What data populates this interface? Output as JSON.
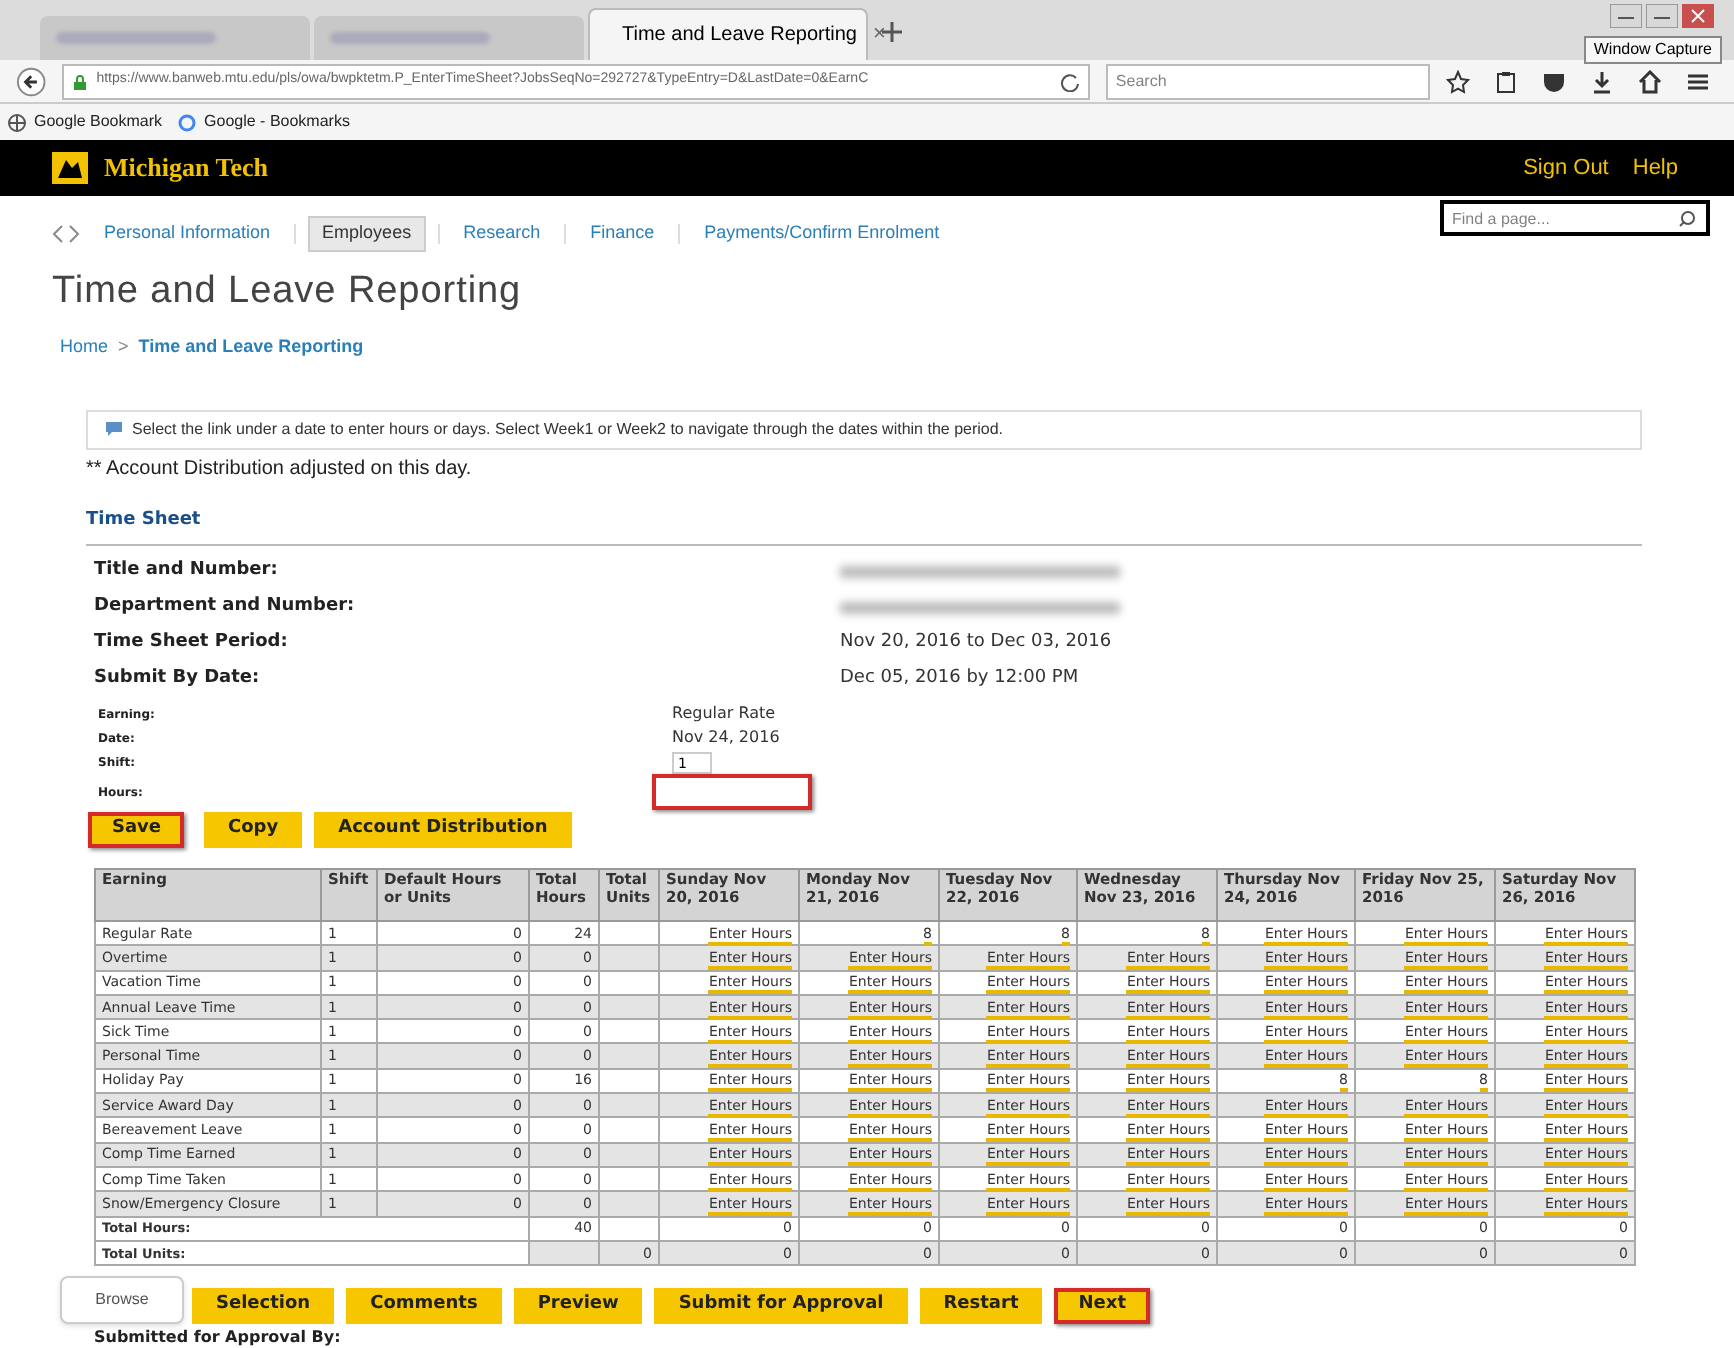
{
  "browser": {
    "tabs": [
      {
        "selected": false
      },
      {
        "selected": false
      },
      {
        "label": "Time and Leave Reporting",
        "selected": true,
        "close": "×"
      }
    ],
    "url": "https://www.banweb.mtu.edu/pls/owa/bwpktetm.P_EnterTimeSheet?JobsSeqNo=292727&TypeEntry=D&LastDate=0&EarnC",
    "search_placeholder": "Search",
    "bookmarks": [
      "Google Bookmark",
      "Google - Bookmarks"
    ],
    "tooltip": "Window Capture"
  },
  "header": {
    "brand": "Michigan Tech",
    "links": [
      "Sign Out",
      "Help"
    ],
    "find_placeholder": "Find a page..."
  },
  "nav": [
    {
      "label": "Personal Information",
      "selected": false
    },
    {
      "label": "Employees",
      "selected": true
    },
    {
      "label": "Research",
      "selected": false
    },
    {
      "label": "Finance",
      "selected": false
    },
    {
      "label": "Payments/Confirm Enrolment",
      "selected": false
    }
  ],
  "page_title": "Time and Leave Reporting",
  "breadcrumb": [
    "Home",
    ">",
    "Time and Leave Reporting"
  ],
  "info": "Select the link under a date to enter hours or days. Select Week1 or Week2 to navigate through the dates within the period.",
  "note": "** Account Distribution adjusted on this day.",
  "section": "Time Sheet",
  "details": [
    {
      "label": "Title and Number:",
      "redacted": true
    },
    {
      "label": "Department and Number:",
      "redacted": true
    },
    {
      "label": "Time Sheet Period:",
      "value": "Nov 20, 2016 to Dec 03, 2016",
      "redacted": false
    },
    {
      "label": "Submit By Date:",
      "value": "Dec 05, 2016 by 12:00 PM",
      "redacted": false
    }
  ],
  "entry": {
    "earning_label": "Earning:",
    "earning": "Regular Rate",
    "date_label": "Date:",
    "date": "Nov 24, 2016",
    "shift_label": "Shift:",
    "shift": "1",
    "hours_label": "Hours:",
    "hours_highlighted": true
  },
  "top_buttons": [
    {
      "label": "Save",
      "highlighted": true
    },
    {
      "label": "Copy",
      "highlighted": false
    },
    {
      "label": "Account Distribution",
      "highlighted": false
    }
  ],
  "table": {
    "columns": [
      "Earning",
      "Shift",
      "Default Hours or Units",
      "Total Hours",
      "Total Units",
      "Sunday Nov 20, 2016",
      "Monday Nov 21, 2016",
      "Tuesday Nov 22, 2016",
      "Wednesday Nov 23, 2016",
      "Thursday Nov 24, 2016",
      "Friday Nov 25, 2016",
      "Saturday Nov 26, 2016"
    ],
    "rows": [
      {
        "earning": "Regular Rate",
        "shift": "1",
        "default": "0",
        "total_hours": "24",
        "days": [
          "Enter Hours",
          "8",
          "8",
          "8",
          "Enter Hours",
          "Enter Hours",
          "Enter Hours"
        ]
      },
      {
        "earning": "Overtime",
        "shift": "1",
        "default": "0",
        "total_hours": "0",
        "days": [
          "Enter Hours",
          "Enter Hours",
          "Enter Hours",
          "Enter Hours",
          "Enter Hours",
          "Enter Hours",
          "Enter Hours"
        ]
      },
      {
        "earning": "Vacation Time",
        "shift": "1",
        "default": "0",
        "total_hours": "0",
        "days": [
          "Enter Hours",
          "Enter Hours",
          "Enter Hours",
          "Enter Hours",
          "Enter Hours",
          "Enter Hours",
          "Enter Hours"
        ]
      },
      {
        "earning": "Annual Leave Time",
        "shift": "1",
        "default": "0",
        "total_hours": "0",
        "days": [
          "Enter Hours",
          "Enter Hours",
          "Enter Hours",
          "Enter Hours",
          "Enter Hours",
          "Enter Hours",
          "Enter Hours"
        ]
      },
      {
        "earning": "Sick Time",
        "shift": "1",
        "default": "0",
        "total_hours": "0",
        "days": [
          "Enter Hours",
          "Enter Hours",
          "Enter Hours",
          "Enter Hours",
          "Enter Hours",
          "Enter Hours",
          "Enter Hours"
        ]
      },
      {
        "earning": "Personal Time",
        "shift": "1",
        "default": "0",
        "total_hours": "0",
        "days": [
          "Enter Hours",
          "Enter Hours",
          "Enter Hours",
          "Enter Hours",
          "Enter Hours",
          "Enter Hours",
          "Enter Hours"
        ]
      },
      {
        "earning": "Holiday Pay",
        "shift": "1",
        "default": "0",
        "total_hours": "16",
        "days": [
          "Enter Hours",
          "Enter Hours",
          "Enter Hours",
          "Enter Hours",
          "8",
          "8",
          "Enter Hours"
        ]
      },
      {
        "earning": "Service Award Day",
        "shift": "1",
        "default": "0",
        "total_hours": "0",
        "days": [
          "Enter Hours",
          "Enter Hours",
          "Enter Hours",
          "Enter Hours",
          "Enter Hours",
          "Enter Hours",
          "Enter Hours"
        ]
      },
      {
        "earning": "Bereavement Leave",
        "shift": "1",
        "default": "0",
        "total_hours": "0",
        "days": [
          "Enter Hours",
          "Enter Hours",
          "Enter Hours",
          "Enter Hours",
          "Enter Hours",
          "Enter Hours",
          "Enter Hours"
        ]
      },
      {
        "earning": "Comp Time Earned",
        "shift": "1",
        "default": "0",
        "total_hours": "0",
        "days": [
          "Enter Hours",
          "Enter Hours",
          "Enter Hours",
          "Enter Hours",
          "Enter Hours",
          "Enter Hours",
          "Enter Hours"
        ]
      },
      {
        "earning": "Comp Time Taken",
        "shift": "1",
        "default": "0",
        "total_hours": "0",
        "days": [
          "Enter Hours",
          "Enter Hours",
          "Enter Hours",
          "Enter Hours",
          "Enter Hours",
          "Enter Hours",
          "Enter Hours"
        ]
      },
      {
        "earning": "Snow/Emergency Closure",
        "shift": "1",
        "default": "0",
        "total_hours": "0",
        "days": [
          "Enter Hours",
          "Enter Hours",
          "Enter Hours",
          "Enter Hours",
          "Enter Hours",
          "Enter Hours",
          "Enter Hours"
        ]
      }
    ],
    "total_hours": {
      "label": "Total Hours:",
      "total": "40",
      "days": [
        "0",
        "0",
        "0",
        "0",
        "0",
        "0",
        "0"
      ]
    },
    "total_units": {
      "label": "Total Units:",
      "total": "0",
      "days": [
        "0",
        "0",
        "0",
        "0",
        "0",
        "0",
        "0"
      ]
    }
  },
  "bottom_buttons": [
    {
      "label": "Selection",
      "highlighted": false
    },
    {
      "label": "Comments",
      "highlighted": false
    },
    {
      "label": "Preview",
      "highlighted": false
    },
    {
      "label": "Submit for Approval",
      "highlighted": false
    },
    {
      "label": "Restart",
      "highlighted": false
    },
    {
      "label": "Next",
      "highlighted": true
    }
  ],
  "browse_button": "Browse",
  "footer_label": "Submitted for Approval By:"
}
